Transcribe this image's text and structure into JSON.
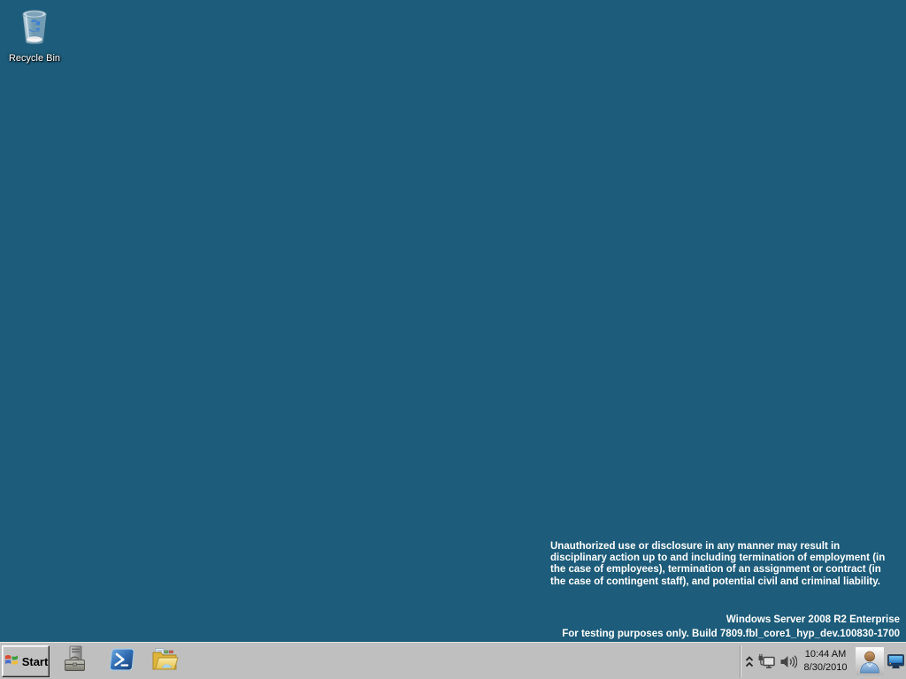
{
  "desktop": {
    "background_color": "#1d5c7a",
    "icons": [
      {
        "name": "recycle-bin",
        "label": "Recycle Bin"
      }
    ],
    "watermark": {
      "notice_lines": [
        "Unauthorized use or disclosure in any manner may result in",
        "disciplinary action up to and including termination of employment (in",
        "the case of employees), termination of an assignment or contract (in",
        "the case of contingent staff), and potential civil and criminal liability."
      ],
      "edition": "Windows Server 2008 R2 Enterprise",
      "build": "For testing purposes only. Build 7809.fbl_core1_hyp_dev.100830-1700"
    }
  },
  "taskbar": {
    "start_label": "Start",
    "pinned": [
      {
        "name": "server-manager",
        "icon": "server-manager-icon"
      },
      {
        "name": "windows-powershell",
        "icon": "powershell-icon"
      },
      {
        "name": "windows-explorer",
        "icon": "explorer-folder-icon"
      }
    ],
    "tray": {
      "icons": [
        {
          "name": "show-hidden-icons",
          "icon": "chevron-up-icon"
        },
        {
          "name": "network-status",
          "icon": "network-plug-icon"
        },
        {
          "name": "volume",
          "icon": "speaker-icon"
        },
        {
          "name": "user-session",
          "icon": "user-bust-icon"
        },
        {
          "name": "display-settings",
          "icon": "monitor-icon"
        }
      ],
      "clock": {
        "time": "10:44 AM",
        "date": "8/30/2010"
      }
    }
  }
}
